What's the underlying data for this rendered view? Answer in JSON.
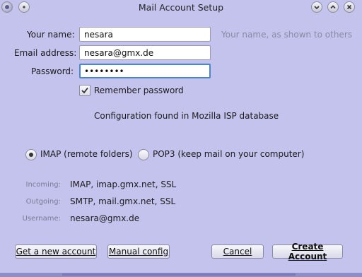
{
  "window": {
    "title": "Mail Account Setup"
  },
  "form": {
    "name_label": "Your name:",
    "name_value": "nesara",
    "name_hint": "Your name, as shown to others",
    "email_label": "Email address:",
    "email_value": "nesara@gmx.de",
    "password_label": "Password:",
    "password_value": "••••••••",
    "remember_label": "Remember password",
    "remember_checked": true
  },
  "status": {
    "message": "Configuration found in Mozilla ISP database"
  },
  "protocol": {
    "imap_label": "IMAP (remote folders)",
    "pop3_label": "POP3 (keep mail on your computer)",
    "selected": "IMAP"
  },
  "summary": {
    "incoming_label": "Incoming:",
    "incoming_value": "IMAP, imap.gmx.net, SSL",
    "outgoing_label": "Outgoing:",
    "outgoing_value": "SMTP, mail.gmx.net, SSL",
    "username_label": "Username:",
    "username_value": "nesara@gmx.de"
  },
  "buttons": {
    "new_account": "Get a new account",
    "manual_config": "Manual config",
    "cancel": "Cancel",
    "create": "Create Account"
  },
  "icons": [
    "thunderbird-icon",
    "menu-icon",
    "minimize-icon",
    "maximize-icon",
    "close-icon",
    "checkmark-icon"
  ],
  "colors": {
    "background": "#c3c3ee",
    "focus_border": "#4a86c8"
  }
}
